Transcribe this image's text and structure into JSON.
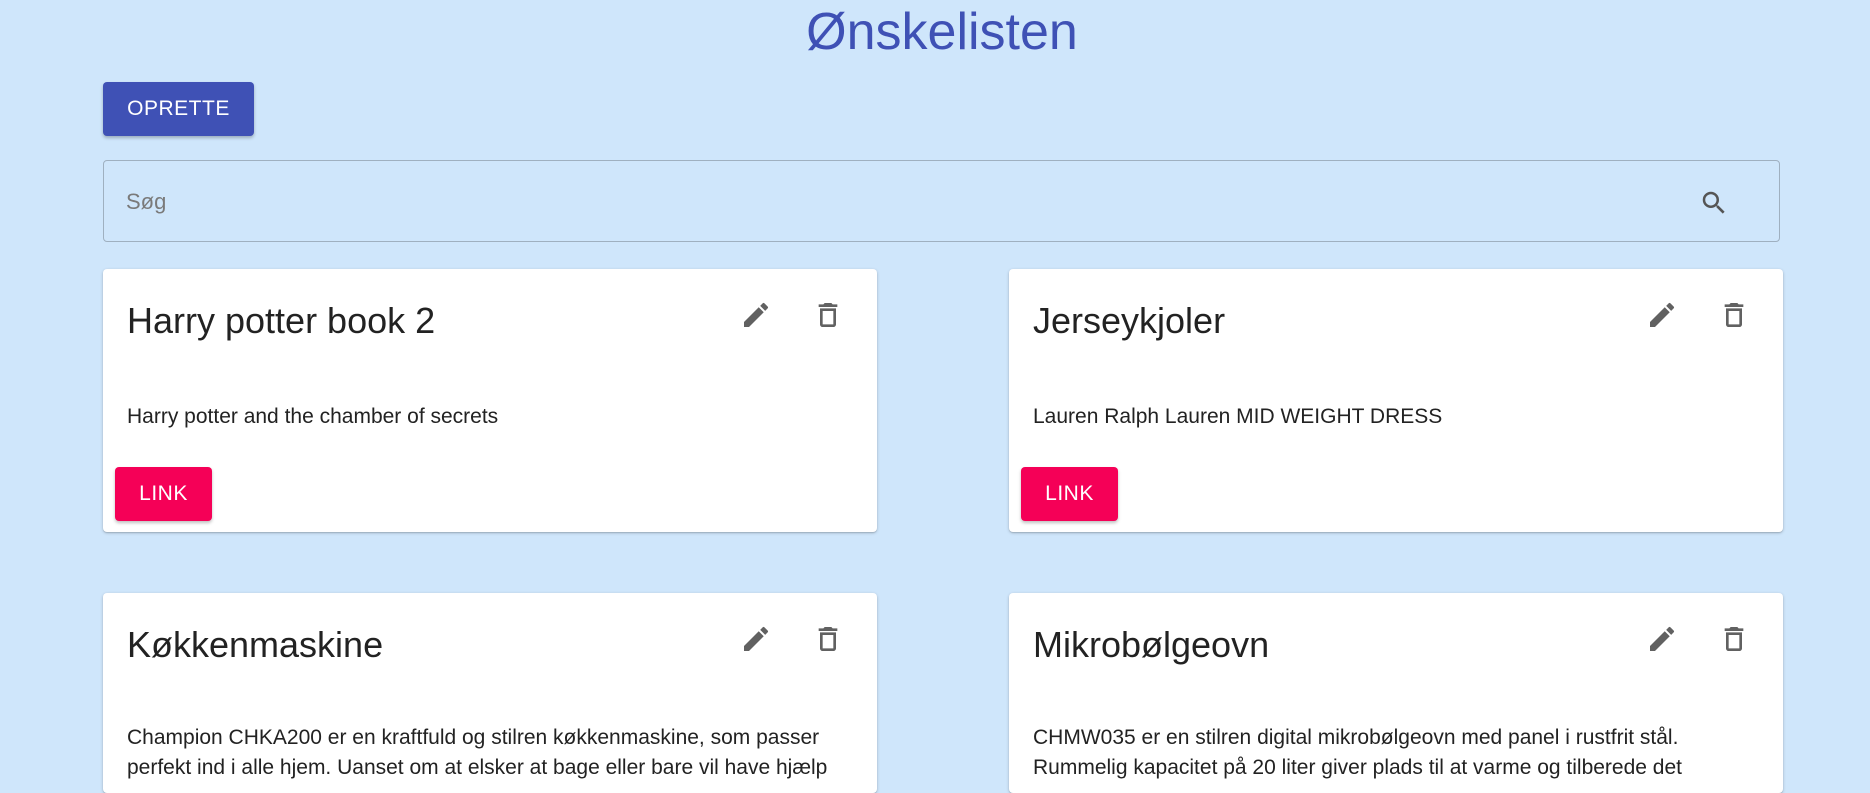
{
  "header": {
    "title": "Ønskelisten",
    "create_label": "OPRETTE"
  },
  "search": {
    "placeholder": "Søg",
    "icon": "search-icon"
  },
  "colors": {
    "background": "#cfe6fb",
    "primary": "#3f51b5",
    "secondary": "#f50057"
  },
  "cards": [
    {
      "title": "Harry potter book 2",
      "description": "Harry potter and the chamber of secrets",
      "link_label": "LINK"
    },
    {
      "title": "Jerseykjoler",
      "description": "Lauren Ralph Lauren MID WEIGHT DRESS",
      "link_label": "LINK"
    },
    {
      "title": "Køkkenmaskine",
      "description": "Champion CHKA200 er en kraftfuld og stilren køkkenmaskine, som passer perfekt ind i alle hjem. Uanset om at elsker at bage eller bare vil have hjælp"
    },
    {
      "title": "Mikrobølgeovn",
      "description": "CHMW035 er en stilren digital mikrobølgeovn med panel i rustfrit stål. Rummelig kapacitet på 20 liter giver plads til at varme og tilberede det"
    }
  ]
}
